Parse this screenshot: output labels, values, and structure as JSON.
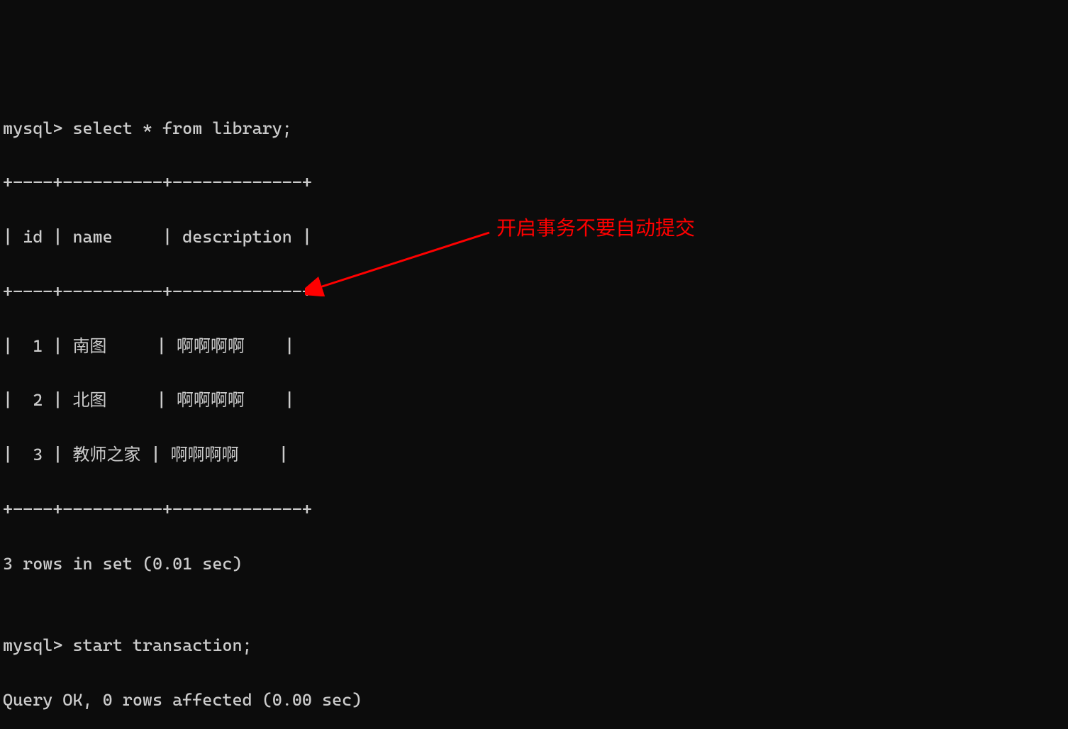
{
  "terminal": {
    "line1": "mysql> select * from library;",
    "line2": "+----+----------+-------------+",
    "line3": "| id | name     | description |",
    "line4": "+----+----------+-------------+",
    "line5": "|  1 | 南图     | 啊啊啊啊    |",
    "line6": "|  2 | 北图     | 啊啊啊啊    |",
    "line7": "|  3 | 教师之家 | 啊啊啊啊    |",
    "line8": "+----+----------+-------------+",
    "line9": "3 rows in set (0.01 sec)",
    "line10": "",
    "line11": "mysql> start transaction;",
    "line12": "Query OK, 0 rows affected (0.00 sec)"
  },
  "annotation": {
    "text": "开启事务不要自动提交"
  },
  "chart_data": {
    "type": "table",
    "columns": [
      "id",
      "name",
      "description"
    ],
    "rows": [
      {
        "id": 1,
        "name": "南图",
        "description": "啊啊啊啊"
      },
      {
        "id": 2,
        "name": "北图",
        "description": "啊啊啊啊"
      },
      {
        "id": 3,
        "name": "教师之家",
        "description": "啊啊啊啊"
      }
    ],
    "result_summary": "3 rows in set (0.01 sec)",
    "commands": [
      "select * from library;",
      "start transaction;"
    ],
    "command_result": "Query OK, 0 rows affected (0.00 sec)"
  }
}
